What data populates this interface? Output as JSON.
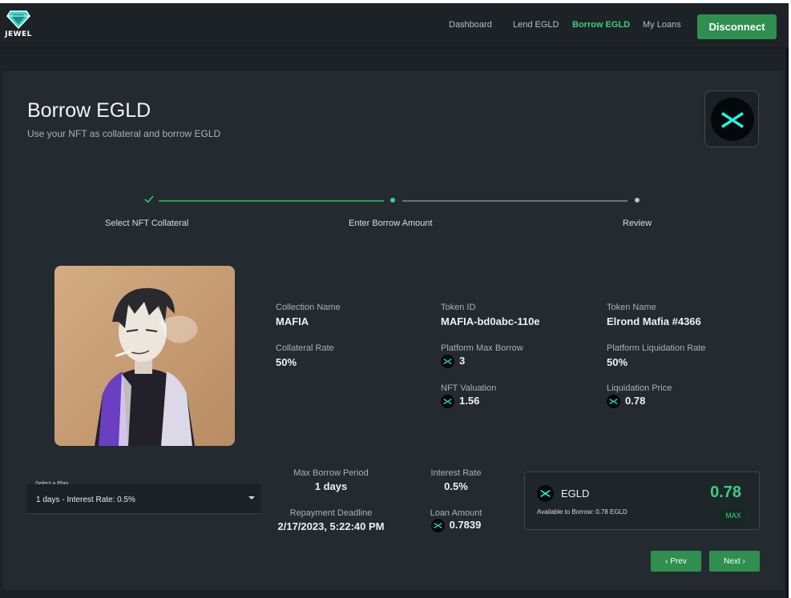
{
  "app": {
    "logo_text": "JEWEL"
  },
  "nav": {
    "dashboard": "Dashboard",
    "lend": "Lend EGLD",
    "borrow": "Borrow EGLD",
    "loans": "My Loans",
    "disconnect": "Disconnect"
  },
  "page": {
    "title": "Borrow EGLD",
    "subtitle": "Use your NFT as collateral and borrow EGLD"
  },
  "steps": [
    {
      "label": "Select NFT Collateral",
      "state": "done"
    },
    {
      "label": "Enter Borrow Amount",
      "state": "active"
    },
    {
      "label": "Review",
      "state": "pending"
    }
  ],
  "nft": {
    "collection_name_label": "Collection Name",
    "collection_name": "MAFIA",
    "token_id_label": "Token ID",
    "token_id": "MAFIA-bd0abc-110e",
    "token_name_label": "Token Name",
    "token_name": "Elrond Mafia #4366",
    "collateral_rate_label": "Collateral Rate",
    "collateral_rate": "50%",
    "platform_max_borrow_label": "Platform Max Borrow",
    "platform_max_borrow": "3",
    "platform_liquidation_rate_label": "Platform Liquidation Rate",
    "platform_liquidation_rate": "50%",
    "nft_valuation_label": "NFT Valuation",
    "nft_valuation": "1.56",
    "liquidation_price_label": "Liquidation Price",
    "liquidation_price": "0.78"
  },
  "plan": {
    "label": "Select a Plan",
    "value": "1 days - Interest Rate: 0.5%"
  },
  "terms": {
    "max_borrow_period_label": "Max Borrow Period",
    "max_borrow_period": "1 days",
    "interest_rate_label": "Interest Rate",
    "interest_rate": "0.5%",
    "repayment_deadline_label": "Repayment Deadline",
    "repayment_deadline": "2/17/2023, 5:22:40 PM",
    "loan_amount_label": "Loan Amount",
    "loan_amount": "0.7839"
  },
  "amount": {
    "unit": "EGLD",
    "value": "0.78",
    "available": "Available to Borrow: 0.78 EGLD",
    "max_label": "MAX"
  },
  "buttons": {
    "prev": "‹ Prev",
    "next": "Next ›"
  },
  "colors": {
    "accent": "#3ccf7d",
    "button": "#2f8f4f",
    "egld": "#23f7dd",
    "background": "#1c2226",
    "card": "#232b30"
  },
  "icons": {
    "logo": "diamond-logo-icon",
    "egld": "egld-icon",
    "check": "check-icon",
    "caret": "chevron-down-icon"
  }
}
